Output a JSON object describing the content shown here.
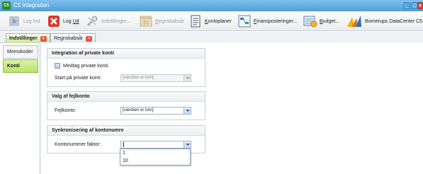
{
  "window": {
    "app_icon": "C5",
    "title": "C5 Integration"
  },
  "toolbar": {
    "login": "Log Ind",
    "logout_prefix": "Log ",
    "logout_underlined": "Ud",
    "settings": "Indstillinger...",
    "reconcile_underlined": "R",
    "reconcile_rest": "egnskabsår",
    "chart_underlined": "K",
    "chart_rest": "ontoplaner",
    "postings_underlined": "F",
    "postings_rest": "inansposteringer...",
    "budget_underlined": "B",
    "budget_rest": "udget...",
    "brand": "Bornerups DataCenter C5"
  },
  "tabs": [
    {
      "label": "Indstillinger"
    },
    {
      "label": "Regnskabsår"
    }
  ],
  "nav": [
    {
      "label": "Momskoder"
    },
    {
      "label": "Konti"
    }
  ],
  "groups": {
    "private": {
      "title": "Integration af private konti",
      "checkbox_label": "Medtag private konti.",
      "start_label": "Start på private konti:",
      "start_value": "[værdien er tom]"
    },
    "error": {
      "title": "Valg af fejlkonto",
      "label": "Fejlkonto:",
      "value": "[værdien er tom]"
    },
    "sync": {
      "title": "Synkronisering af kontonumre",
      "label": "Kontonummer faktor:",
      "value": ""
    }
  },
  "dropdown_options": [
    "1",
    "10"
  ],
  "colors": {
    "titlebar": "#4f9fd8",
    "active_tab": "#c9e59a",
    "selected_nav": "#b8e46e",
    "close_red": "#d9473b"
  }
}
